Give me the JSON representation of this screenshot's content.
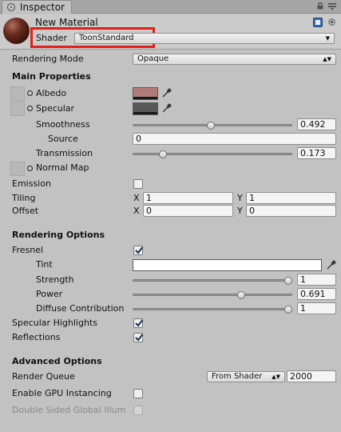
{
  "window": {
    "tab_title": "Inspector",
    "icons": {
      "tab": "inspector-icon",
      "lock": "lock-icon",
      "menu": "menu-icon"
    }
  },
  "header": {
    "material_name": "New Material",
    "shader_label": "Shader",
    "shader_value": "ToonStandard",
    "highlight_color": "#e0201a"
  },
  "rendering_mode": {
    "label": "Rendering Mode",
    "value": "Opaque"
  },
  "main_properties": {
    "title": "Main Properties",
    "albedo": {
      "label": "Albedo",
      "color": "#b07b78"
    },
    "specular": {
      "label": "Specular",
      "color": "#595959"
    },
    "smoothness": {
      "label": "Smoothness",
      "value": "0.492",
      "fraction": 0.492
    },
    "source": {
      "label": "Source",
      "value": "0"
    },
    "transmission": {
      "label": "Transmission",
      "value": "0.173",
      "fraction": 0.173
    },
    "normal_map": {
      "label": "Normal Map"
    }
  },
  "emission": {
    "label": "Emission",
    "checked": false
  },
  "tiling": {
    "label": "Tiling",
    "x_label": "X",
    "x": "1",
    "y_label": "Y",
    "y": "1"
  },
  "offset": {
    "label": "Offset",
    "x_label": "X",
    "x": "0",
    "y_label": "Y",
    "y": "0"
  },
  "rendering_options": {
    "title": "Rendering Options",
    "fresnel": {
      "label": "Fresnel",
      "checked": true
    },
    "tint": {
      "label": "Tint",
      "color": "#ffffff"
    },
    "strength": {
      "label": "Strength",
      "value": "1",
      "fraction": 1.0
    },
    "power": {
      "label": "Power",
      "value": "0.691",
      "fraction": 0.691
    },
    "diffuse_contribution": {
      "label": "Diffuse Contribution",
      "value": "1",
      "fraction": 1.0
    },
    "specular_highlights": {
      "label": "Specular Highlights",
      "checked": true
    },
    "reflections": {
      "label": "Reflections",
      "checked": true
    }
  },
  "advanced_options": {
    "title": "Advanced Options",
    "render_queue": {
      "label": "Render Queue",
      "dropdown": "From Shader",
      "value": "2000"
    },
    "gpu_instancing": {
      "label": "Enable GPU Instancing",
      "checked": false
    },
    "double_sided": {
      "label": "Double Sided Global Illum",
      "checked": false,
      "disabled": true
    }
  }
}
